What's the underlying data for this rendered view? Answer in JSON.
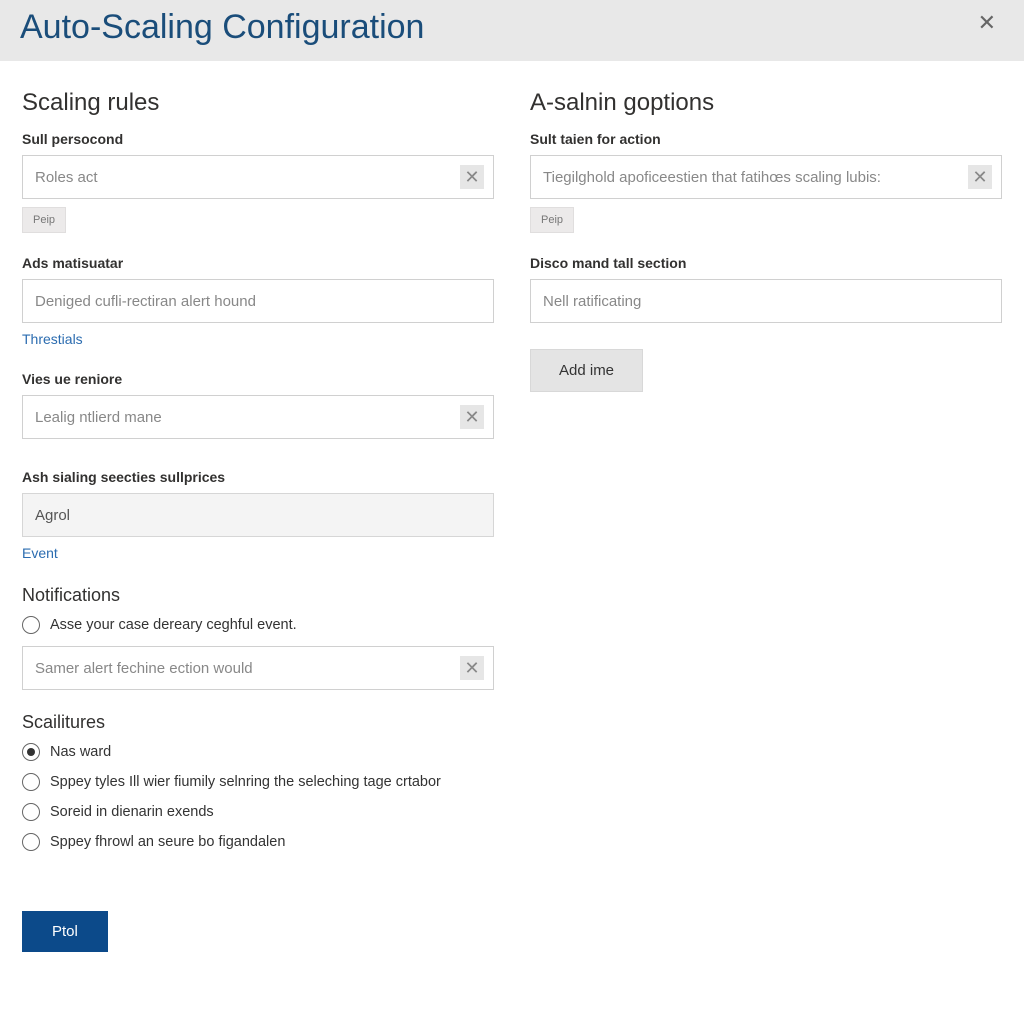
{
  "header": {
    "title": "Auto-Scaling Configuration",
    "close": "✕"
  },
  "left": {
    "heading": "Scaling rules",
    "field1": {
      "label": "Sull persocond",
      "value": "Roles act",
      "help_btn": "Peip"
    },
    "field2": {
      "label": "Ads matisuatar",
      "value": "Deniged cufli-rectiran alert hound",
      "link": "Threstials"
    },
    "field3": {
      "label": "Vies ue reniore",
      "value": "Lealig ntlierd mane"
    },
    "field4": {
      "label": "Ash sialing seecties sullprices",
      "value": "Agrol",
      "link": "Event"
    },
    "notifications": {
      "heading": "Notifications",
      "radio": "Asse your case dereary ceghful event.",
      "input": "Samer alert fechine ection would"
    },
    "scailitures": {
      "heading": "Scailitures",
      "options": [
        "Nas ward",
        "Sppey tyles Ill wier fiumily selnring the seleching tage crtabor",
        "Soreid in dienarin exends",
        "Sppey fhrowl an seure bo figandalen"
      ]
    },
    "primary": "Ptol"
  },
  "right": {
    "heading": "A-salnin goptions",
    "field1": {
      "label": "Sult taien for action",
      "value": "Tiegilghold apoficeestien that fatihœs scaling lubis:",
      "help_btn": "Peip"
    },
    "field2": {
      "label": "Disco mand tall section",
      "value": "Nell ratificating"
    },
    "add_btn": "Add ime"
  }
}
